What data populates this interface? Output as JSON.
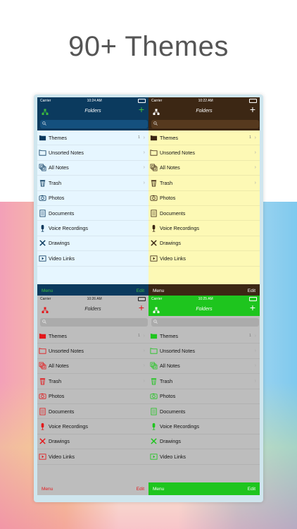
{
  "headline": "90+ Themes",
  "device": {
    "carrier": "Carrier",
    "search_icon": "search-icon",
    "nav_title": "Folders",
    "add_symbol": "+",
    "menu_label": "Menu",
    "edit_label": "Edit",
    "chevron": "›",
    "themes_count": "1",
    "items": [
      "Themes",
      "Unsorted Notes",
      "All Notes",
      "Trash",
      "Photos",
      "Documents",
      "Voice Recordings",
      "Drawings",
      "Video Links"
    ],
    "item_icons": [
      "folder-icon",
      "folder-outline-icon",
      "all-notes-icon",
      "trash-icon",
      "photos-icon",
      "documents-icon",
      "microphone-icon",
      "drawings-icon",
      "video-links-icon"
    ],
    "panes": [
      {
        "time": "10:24 AM",
        "status_bg": "#0b3a5e",
        "status_fg": "#ffffff",
        "nav_bg": "#0b3a5e",
        "nav_fg": "#ffffff",
        "search_bg": "#0b3a5e",
        "search_box": "#14507e",
        "list_bg": "#e6f6ff",
        "text": "#111111",
        "accent": "#0b3a5e",
        "toolbar_bg": "#0b3a5e",
        "toolbar_fg": "#ffffff",
        "logo_color": "#3dbb3d",
        "plus_color": "#3dbb3d",
        "menu_color": "#3dbb3d",
        "edit_color": "#3dbb3d"
      },
      {
        "time": "10:22 AM",
        "status_bg": "#3c2714",
        "status_fg": "#ffffff",
        "nav_bg": "#3c2714",
        "nav_fg": "#ffffff",
        "search_bg": "#3c2714",
        "search_box": "#56391e",
        "list_bg": "#fdf9b5",
        "text": "#111111",
        "accent": "#3c2714",
        "toolbar_bg": "#3c2714",
        "toolbar_fg": "#ffffff",
        "logo_color": "#ffffff",
        "plus_color": "#ffffff",
        "menu_color": "#ffffff",
        "edit_color": "#ffffff"
      },
      {
        "time": "10:26 AM",
        "status_bg": "#bdbdbd",
        "status_fg": "#222222",
        "nav_bg": "#bdbdbd",
        "nav_fg": "#222222",
        "search_bg": "#bdbdbd",
        "search_box": "#ababab",
        "list_bg": "#bdbdbd",
        "text": "#111111",
        "accent": "#e3171b",
        "toolbar_bg": "#bdbdbd",
        "toolbar_fg": "#e3171b",
        "logo_color": "#e3171b",
        "plus_color": "#e3171b",
        "menu_color": "#e3171b",
        "edit_color": "#e3171b"
      },
      {
        "time": "10:25 AM",
        "status_bg": "#1ec51e",
        "status_fg": "#ffffff",
        "nav_bg": "#1ec51e",
        "nav_fg": "#ffffff",
        "search_bg": "#bdbdbd",
        "search_box": "#ababab",
        "list_bg": "#bdbdbd",
        "text": "#111111",
        "accent": "#1ec51e",
        "toolbar_bg": "#1ec51e",
        "toolbar_fg": "#ffffff",
        "logo_color": "#ffffff",
        "plus_color": "#ffffff",
        "menu_color": "#ffffff",
        "edit_color": "#ffffff"
      }
    ]
  }
}
